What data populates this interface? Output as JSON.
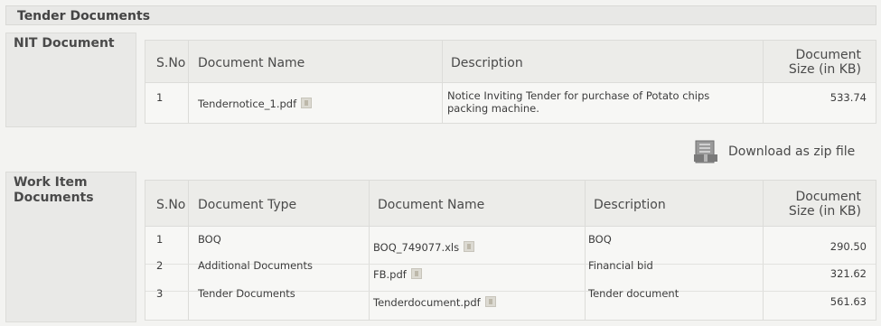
{
  "panel_title": "Tender Documents",
  "nit": {
    "label": "NIT Document",
    "headers": {
      "sno": "S.No",
      "name": "Document Name",
      "desc": "Description",
      "size_line1": "Document",
      "size_line2": "Size (in KB)"
    },
    "rows": [
      {
        "sno": "1",
        "name": "Tendernotice_1.pdf",
        "desc_line1": "Notice Inviting Tender for purchase of Potato chips",
        "desc_line2": "packing machine.",
        "size": "533.74"
      }
    ]
  },
  "zip": {
    "label": "Download as zip file",
    "icon": "zip-archive-icon"
  },
  "work": {
    "label_line1": "Work Item",
    "label_line2": "Documents",
    "headers": {
      "sno": "S.No",
      "type": "Document Type",
      "name": "Document Name",
      "desc": "Description",
      "size_line1": "Document",
      "size_line2": "Size (in KB)"
    },
    "rows": [
      {
        "sno": "1",
        "type": "BOQ",
        "name": "BOQ_749077.xls",
        "desc": "BOQ",
        "size": "290.50"
      },
      {
        "sno": "2",
        "type": "Additional Documents",
        "name": "FB.pdf",
        "desc": "Financial bid",
        "size": "321.62"
      },
      {
        "sno": "3",
        "type": "Tender Documents",
        "name": "Tenderdocument.pdf",
        "desc": "Tender document",
        "size": "561.63"
      }
    ]
  }
}
